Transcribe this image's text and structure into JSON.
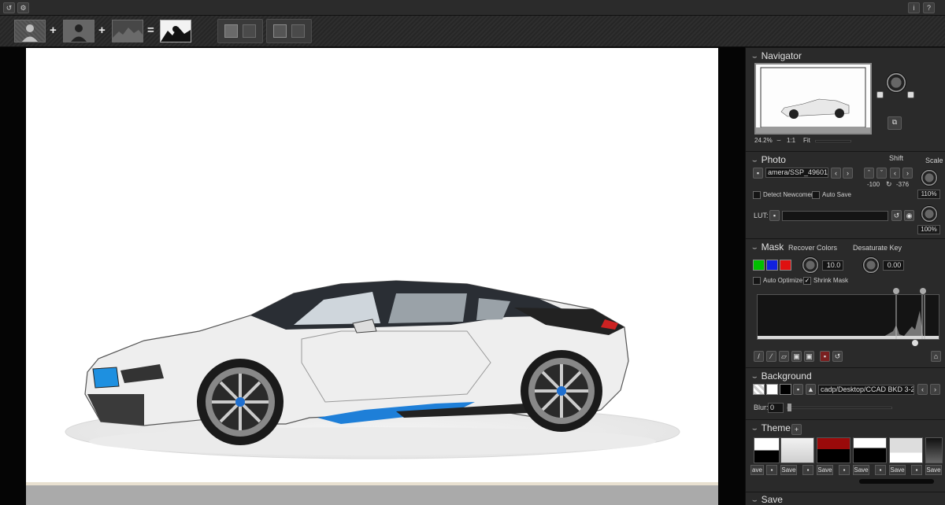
{
  "topbar": {
    "undo_icon": "undo-icon",
    "settings_icon": "gear-icon",
    "info_label": "i",
    "help_label": "?"
  },
  "toolbar": {
    "plus1": "+",
    "plus2": "+",
    "equals": "="
  },
  "navigator": {
    "title": "Navigator",
    "zoom": "24.2%",
    "one_to_one": "1:1",
    "fit": "Fit"
  },
  "photo": {
    "title": "Photo",
    "shift_label": "Shift",
    "scale_label": "Scale",
    "file": "amera/SSP_49601.jpg",
    "shift_x": "-100",
    "shift_y": "-376",
    "scale1": "110%",
    "detect_newcomer": "Detect Newcomer",
    "auto_save": "Auto Save",
    "lut_label": "LUT:",
    "lut_value": "",
    "scale2": "100%"
  },
  "mask": {
    "title": "Mask",
    "recover_colors": "Recover Colors",
    "desaturate_key": "Desaturate Key",
    "recover_value": "10.0",
    "desaturate_value": "0.00",
    "auto_optimize": "Auto Optimize",
    "shrink_mask": "Shrink Mask",
    "colors": [
      "#00c000",
      "#1020e0",
      "#e01010"
    ]
  },
  "background": {
    "title": "Background",
    "file": "cadp/Desktop/CCAD BKD 3-27.png",
    "blur_label": "Blur:",
    "blur_value": "0"
  },
  "theme": {
    "title": "Theme",
    "save_label": "Save",
    "first_save_label": "ave"
  },
  "save_section": {
    "title": "Save"
  }
}
